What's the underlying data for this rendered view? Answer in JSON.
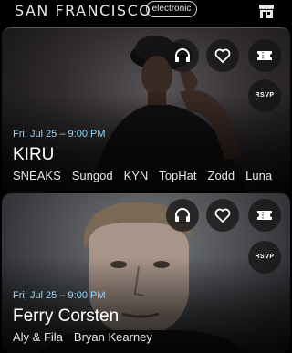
{
  "header": {
    "city": "SAN FRANCISCO",
    "genre": "electronic"
  },
  "events": [
    {
      "date": "Fri, Jul 25 – 9:00 PM",
      "title": "KIRU",
      "lineup": [
        "SNEAKS",
        "Sungod",
        "KYN",
        "TopHat",
        "Zodd",
        "Luna"
      ],
      "rsvp_label": "RSVP"
    },
    {
      "date": "Fri, Jul 25 – 9:00 PM",
      "title": "Ferry Corsten",
      "lineup": [
        "Aly & Fila",
        "Bryan Kearney"
      ],
      "rsvp_label": "RSVP"
    }
  ],
  "icons": {
    "listen": "headphones-icon",
    "favorite": "heart-icon",
    "tickets": "ticket-icon",
    "store": "storefront-icon"
  },
  "colors": {
    "date_accent": "#8fd7ff",
    "background": "#000000"
  }
}
